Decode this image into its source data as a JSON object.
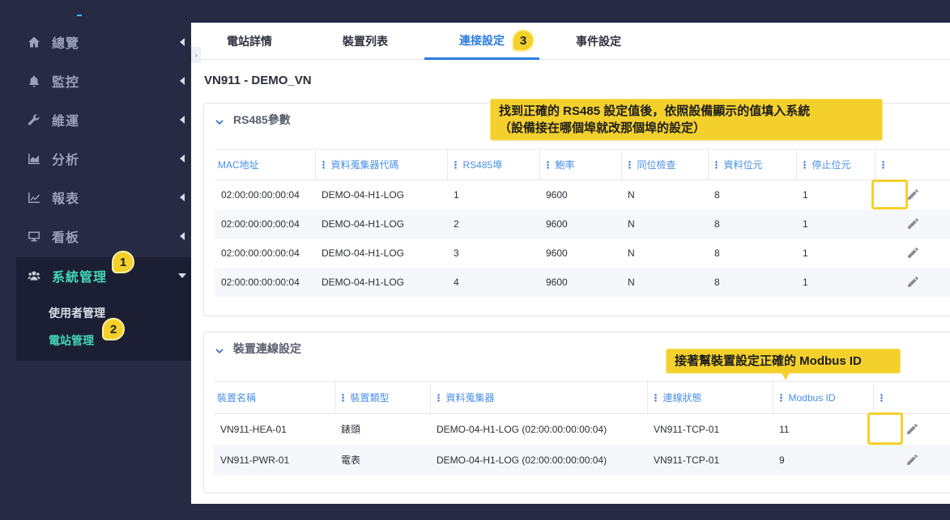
{
  "sidebar": {
    "items": [
      {
        "label": "總覽",
        "icon": "home-icon"
      },
      {
        "label": "監控",
        "icon": "bell-icon"
      },
      {
        "label": "維運",
        "icon": "wrench-icon"
      },
      {
        "label": "分析",
        "icon": "area-chart-icon"
      },
      {
        "label": "報表",
        "icon": "line-chart-icon"
      },
      {
        "label": "看板",
        "icon": "monitor-icon"
      },
      {
        "label": "系統管理",
        "icon": "users-icon"
      }
    ],
    "subitems": [
      {
        "label": "使用者管理"
      },
      {
        "label": "電站管理"
      }
    ]
  },
  "steps": {
    "one": "1",
    "two": "2",
    "three": "3"
  },
  "tabs": [
    {
      "label": "電站詳情"
    },
    {
      "label": "裝置列表"
    },
    {
      "label": "連接設定"
    },
    {
      "label": "事件設定"
    }
  ],
  "station_title": "VN911 - DEMO_VN",
  "rs485": {
    "title": "RS485參數",
    "columns": [
      "MAC地址",
      "資料蒐集器代碼",
      "RS485埠",
      "鮑率",
      "同位檢查",
      "資料位元",
      "停止位元"
    ],
    "rows": [
      [
        "02:00:00:00:00:04",
        "DEMO-04-H1-LOG",
        "1",
        "9600",
        "N",
        "8",
        "1"
      ],
      [
        "02:00:00:00:00:04",
        "DEMO-04-H1-LOG",
        "2",
        "9600",
        "N",
        "8",
        "1"
      ],
      [
        "02:00:00:00:00:04",
        "DEMO-04-H1-LOG",
        "3",
        "9600",
        "N",
        "8",
        "1"
      ],
      [
        "02:00:00:00:00:04",
        "DEMO-04-H1-LOG",
        "4",
        "9600",
        "N",
        "8",
        "1"
      ]
    ]
  },
  "device": {
    "title": "裝置連線設定",
    "columns": [
      "裝置名稱",
      "裝置類型",
      "資料蒐集器",
      "連線狀態",
      "Modbus ID"
    ],
    "rows": [
      [
        "VN911-HEA-01",
        "錶頭",
        "DEMO-04-H1-LOG (02:00:00:00:00:04)",
        "VN911-TCP-01",
        "11"
      ],
      [
        "VN911-PWR-01",
        "電表",
        "DEMO-04-H1-LOG (02:00:00:00:00:04)",
        "VN911-TCP-01",
        "9"
      ]
    ]
  },
  "callouts": {
    "rs485_line1": "找到正確的 RS485 設定值後，依照設備顯示的值填入系統",
    "rs485_line2": "（設備接在哪個埠就改那個埠的設定）",
    "modbus": "接著幫裝置設定正確的 Modbus ID"
  },
  "colors": {
    "accent": "#2c7be0",
    "highlight": "#f4d02c",
    "sidebar_bg": "#262a43",
    "active_text": "#41d6b6"
  }
}
